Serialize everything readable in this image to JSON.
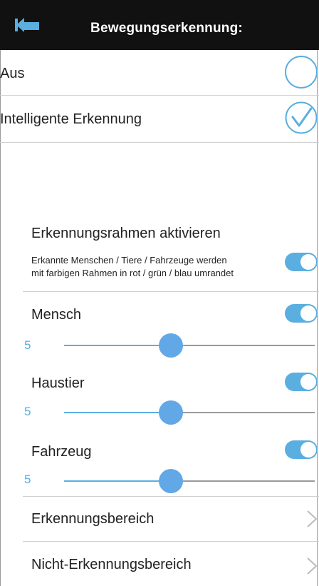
{
  "header": {
    "title": "Bewegungserkennung:"
  },
  "options": [
    {
      "label": "Aus",
      "selected": false
    },
    {
      "label": "Intelligente Erkennung",
      "selected": true
    }
  ],
  "frame": {
    "title": "Erkennungsrahmen aktivieren",
    "description_line1": "Erkannte Menschen / Tiere / Fahrzeuge werden",
    "description_line2": "mit farbigen Rahmen in rot / grün / blau umrandet",
    "toggle_on": true
  },
  "detectors": [
    {
      "label": "Mensch",
      "value": "5",
      "toggle_on": true,
      "level": 0.5
    },
    {
      "label": "Haustier",
      "value": "5",
      "toggle_on": true,
      "level": 0.5
    },
    {
      "label": "Fahrzeug",
      "value": "5",
      "toggle_on": true,
      "level": 0.5
    }
  ],
  "nav": [
    {
      "label": "Erkennungsbereich"
    },
    {
      "label": "Nicht-Erkennungsbereich"
    }
  ],
  "colors": {
    "accent": "#5aaee0",
    "header_bg": "#111111"
  }
}
